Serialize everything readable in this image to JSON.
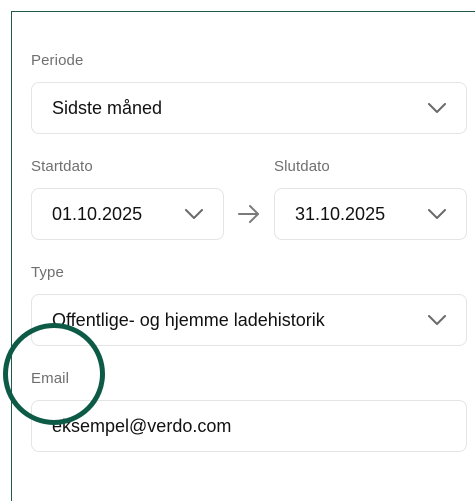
{
  "form": {
    "period": {
      "label": "Periode",
      "value": "Sidste måned"
    },
    "start_date": {
      "label": "Startdato",
      "value": "01.10.2025"
    },
    "end_date": {
      "label": "Slutdato",
      "value": "31.10.2025"
    },
    "type": {
      "label": "Type",
      "value": "Offentlige- og hjemme ladehistorik"
    },
    "email": {
      "label": "Email",
      "value": "eksempel@verdo.com"
    }
  },
  "icons": {
    "dropdown": "chevron-down-icon",
    "range": "arrow-right-icon",
    "highlight": "circle-highlight"
  },
  "colors": {
    "accent": "#0d5a46",
    "panel_border": "#1f5c48",
    "field_border": "#e4e4e4",
    "label": "#6f6f6f",
    "text": "#111111"
  }
}
